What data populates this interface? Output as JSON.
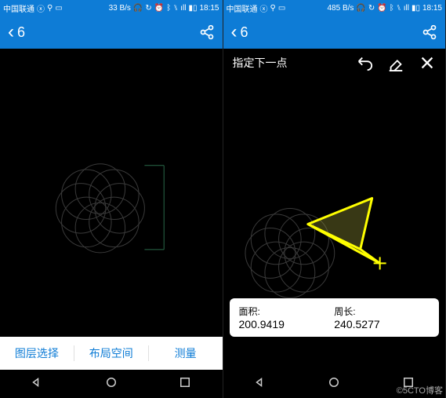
{
  "left": {
    "status": {
      "carrier": "中国联通",
      "speed": "33 B/s",
      "time": "18:15"
    },
    "appbar": {
      "title": "6"
    },
    "tabs": [
      "图层选择",
      "布局空间",
      "测量"
    ]
  },
  "right": {
    "status": {
      "carrier": "中国联通",
      "speed": "485 B/s",
      "time": "18:15"
    },
    "appbar": {
      "title": "6"
    },
    "prompt": "指定下一点",
    "result": {
      "area_label": "面积:",
      "area_value": "200.9419",
      "perimeter_label": "周长:",
      "perimeter_value": "240.5277"
    }
  },
  "watermark": "©5CTO博客"
}
